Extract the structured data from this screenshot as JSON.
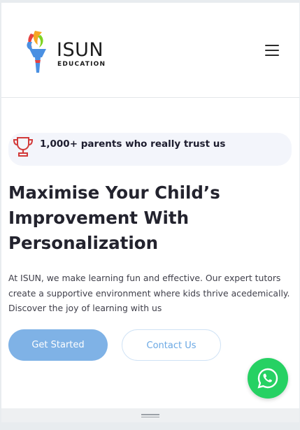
{
  "brand": {
    "name": "ISUN",
    "tagline": "EDUCATION",
    "logo_colors": [
      "#e5413f",
      "#f5a623",
      "#4a90e2",
      "#7ed321"
    ]
  },
  "header": {
    "menu_icon": "hamburger-icon"
  },
  "trust_badge": {
    "icon": "trophy-icon",
    "text": "1,000+ parents who really trust us",
    "icon_color": "#d23a3a"
  },
  "hero": {
    "title": "Maximise Your Child’s Improvement With Personalization",
    "description": "At ISUN, we make learning fun and effective. Our expert tutors create a supportive environment where kids thrive acedemically. Discover the joy of learning with us"
  },
  "buttons": {
    "primary_label": "Get Started",
    "secondary_label": "Contact Us"
  },
  "floating": {
    "icon": "whatsapp-icon",
    "color": "#26d163"
  },
  "bottom_bar": {
    "icon": "drag-handle-icon"
  }
}
